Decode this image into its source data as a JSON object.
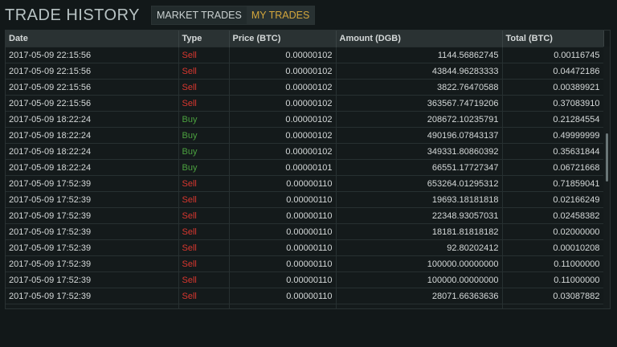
{
  "header": {
    "title": "TRADE HISTORY",
    "tabs": [
      {
        "label": "MARKET TRADES",
        "active": false
      },
      {
        "label": "MY TRADES",
        "active": true
      }
    ]
  },
  "table": {
    "columns": [
      "Date",
      "Type",
      "Price (BTC)",
      "Amount (DGB)",
      "Total (BTC)"
    ],
    "rows": [
      {
        "date": "2017-05-09 22:15:56",
        "type": "Sell",
        "price": "0.00000102",
        "amount": "1144.56862745",
        "total": "0.00116745"
      },
      {
        "date": "2017-05-09 22:15:56",
        "type": "Sell",
        "price": "0.00000102",
        "amount": "43844.96283333",
        "total": "0.04472186"
      },
      {
        "date": "2017-05-09 22:15:56",
        "type": "Sell",
        "price": "0.00000102",
        "amount": "3822.76470588",
        "total": "0.00389921"
      },
      {
        "date": "2017-05-09 22:15:56",
        "type": "Sell",
        "price": "0.00000102",
        "amount": "363567.74719206",
        "total": "0.37083910"
      },
      {
        "date": "2017-05-09 18:22:24",
        "type": "Buy",
        "price": "0.00000102",
        "amount": "208672.10235791",
        "total": "0.21284554"
      },
      {
        "date": "2017-05-09 18:22:24",
        "type": "Buy",
        "price": "0.00000102",
        "amount": "490196.07843137",
        "total": "0.49999999"
      },
      {
        "date": "2017-05-09 18:22:24",
        "type": "Buy",
        "price": "0.00000102",
        "amount": "349331.80860392",
        "total": "0.35631844"
      },
      {
        "date": "2017-05-09 18:22:24",
        "type": "Buy",
        "price": "0.00000101",
        "amount": "66551.17727347",
        "total": "0.06721668"
      },
      {
        "date": "2017-05-09 17:52:39",
        "type": "Sell",
        "price": "0.00000110",
        "amount": "653264.01295312",
        "total": "0.71859041"
      },
      {
        "date": "2017-05-09 17:52:39",
        "type": "Sell",
        "price": "0.00000110",
        "amount": "19693.18181818",
        "total": "0.02166249"
      },
      {
        "date": "2017-05-09 17:52:39",
        "type": "Sell",
        "price": "0.00000110",
        "amount": "22348.93057031",
        "total": "0.02458382"
      },
      {
        "date": "2017-05-09 17:52:39",
        "type": "Sell",
        "price": "0.00000110",
        "amount": "18181.81818182",
        "total": "0.02000000"
      },
      {
        "date": "2017-05-09 17:52:39",
        "type": "Sell",
        "price": "0.00000110",
        "amount": "92.80202412",
        "total": "0.00010208"
      },
      {
        "date": "2017-05-09 17:52:39",
        "type": "Sell",
        "price": "0.00000110",
        "amount": "100000.00000000",
        "total": "0.11000000"
      },
      {
        "date": "2017-05-09 17:52:39",
        "type": "Sell",
        "price": "0.00000110",
        "amount": "100000.00000000",
        "total": "0.11000000"
      },
      {
        "date": "2017-05-09 17:52:39",
        "type": "Sell",
        "price": "0.00000110",
        "amount": "28071.66363636",
        "total": "0.03087882"
      }
    ]
  },
  "colors": {
    "sell": "#d8372f",
    "buy": "#4ba13f",
    "active_tab": "#d3a63c"
  }
}
